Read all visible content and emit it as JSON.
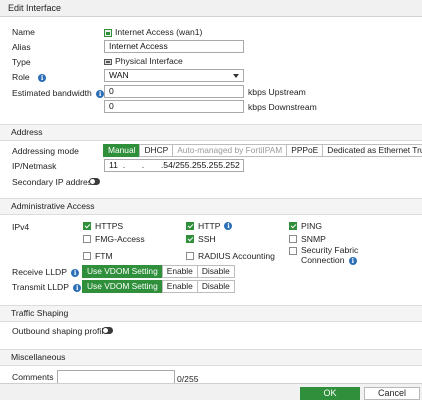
{
  "window": {
    "title": "Edit Interface"
  },
  "general": {
    "name_label": "Name",
    "name_value": "Internet Access (wan1)",
    "alias_label": "Alias",
    "alias_value": "Internet Access",
    "type_label": "Type",
    "type_value": "Physical Interface",
    "role_label": "Role",
    "role_value": "WAN",
    "bandwidth_label": "Estimated bandwidth",
    "upstream_value": "0",
    "upstream_unit": "kbps Upstream",
    "downstream_value": "0",
    "downstream_unit": "kbps Downstream"
  },
  "address": {
    "section_title": "Address",
    "mode_label": "Addressing mode",
    "modes": [
      {
        "label": "Manual",
        "state": "active"
      },
      {
        "label": "DHCP",
        "state": "normal"
      },
      {
        "label": "Auto-managed by FortiIPAM",
        "state": "disabled"
      },
      {
        "label": "PPPoE",
        "state": "normal"
      },
      {
        "label": "Dedicated as Ethernet Trunk",
        "state": "normal"
      }
    ],
    "ip_label": "IP/Netmask",
    "ip_value": "11  .       .       .54/255.255.255.252",
    "secondary_label": "Secondary IP address"
  },
  "admin_access": {
    "section_title": "Administrative Access",
    "ipv4_label": "IPv4",
    "options": [
      {
        "label": "HTTPS",
        "checked": true,
        "info": false
      },
      {
        "label": "HTTP",
        "checked": true,
        "info": true
      },
      {
        "label": "PING",
        "checked": true,
        "info": false
      },
      {
        "label": "FMG-Access",
        "checked": false,
        "info": false
      },
      {
        "label": "SSH",
        "checked": true,
        "info": false
      },
      {
        "label": "SNMP",
        "checked": false,
        "info": false
      },
      {
        "label": "FTM",
        "checked": false,
        "info": false
      },
      {
        "label": "RADIUS Accounting",
        "checked": false,
        "info": false
      },
      {
        "label": "Security Fabric",
        "label2": "Connection",
        "checked": false,
        "info": true
      }
    ],
    "receive_lldp_label": "Receive LLDP",
    "transmit_lldp_label": "Transmit LLDP",
    "lldp_options": [
      "Use VDOM Setting",
      "Enable",
      "Disable"
    ]
  },
  "traffic_shaping": {
    "section_title": "Traffic Shaping",
    "outbound_label": "Outbound shaping profile"
  },
  "misc": {
    "section_title": "Miscellaneous",
    "comments_label": "Comments",
    "comments_counter": "0/255"
  },
  "footer": {
    "ok_label": "OK",
    "cancel_label": "Cancel"
  },
  "colors": {
    "accent": "#2f8f3a",
    "info": "#2c6fb6"
  },
  "icons": {
    "info": "info-icon",
    "interface": "network-port-icon",
    "physical": "physical-interface-icon"
  }
}
